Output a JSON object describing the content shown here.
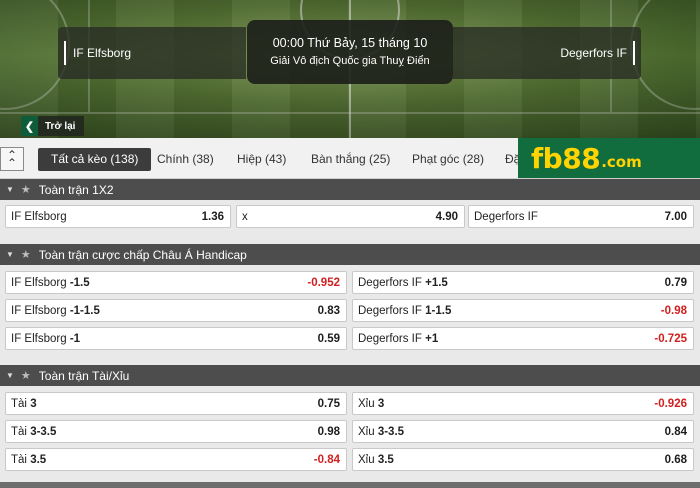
{
  "match": {
    "home_team": "IF Elfsborg",
    "away_team": "Degerfors IF",
    "datetime": "00:00 Thứ Bảy, 15 tháng 10",
    "league": "Giải Vô địch Quốc gia Thuỵ Điển"
  },
  "back_label": "Trở lại",
  "tabs": [
    {
      "label": "Tất cả kèo (138)",
      "active": true
    },
    {
      "label": "Chính (38)"
    },
    {
      "label": "Hiệp (43)"
    },
    {
      "label": "Bàn thắng (25)"
    },
    {
      "label": "Phạt góc (28)"
    },
    {
      "label": "Đặ"
    }
  ],
  "logo": {
    "main": "fb88",
    "suffix": ".com"
  },
  "markets": {
    "m1x2": {
      "title": "Toàn trận 1X2",
      "odds": [
        {
          "name": "IF Elfsborg",
          "price": "1.36"
        },
        {
          "name": "x",
          "price": "4.90"
        },
        {
          "name": "Degerfors IF",
          "price": "7.00"
        }
      ]
    },
    "handicap": {
      "title": "Toàn trận cược chấp Châu Á Handicap",
      "rows": [
        [
          {
            "name": "IF Elfsborg",
            "line": "-1.5",
            "price": "-0.952"
          },
          {
            "name": "Degerfors IF",
            "line": "+1.5",
            "price": "0.79"
          }
        ],
        [
          {
            "name": "IF Elfsborg",
            "line": "-1-1.5",
            "price": "0.83"
          },
          {
            "name": "Degerfors IF",
            "line": "1-1.5",
            "price": "-0.98"
          }
        ],
        [
          {
            "name": "IF Elfsborg",
            "line": "-1",
            "price": "0.59"
          },
          {
            "name": "Degerfors IF",
            "line": "+1",
            "price": "-0.725"
          }
        ]
      ]
    },
    "overunder": {
      "title": "Toàn trận Tài/Xỉu",
      "rows": [
        [
          {
            "name": "Tài",
            "line": "3",
            "price": "0.75"
          },
          {
            "name": "Xỉu",
            "line": "3",
            "price": "-0.926"
          }
        ],
        [
          {
            "name": "Tài",
            "line": "3-3.5",
            "price": "0.98"
          },
          {
            "name": "Xỉu",
            "line": "3-3.5",
            "price": "0.84"
          }
        ],
        [
          {
            "name": "Tài",
            "line": "3.5",
            "price": "-0.84"
          },
          {
            "name": "Xỉu",
            "line": "3.5",
            "price": "0.68"
          }
        ]
      ]
    }
  },
  "colors": {
    "negative_price": "#d11f1f",
    "brand_green": "#116c3e",
    "brand_yellow": "#ffd400"
  }
}
